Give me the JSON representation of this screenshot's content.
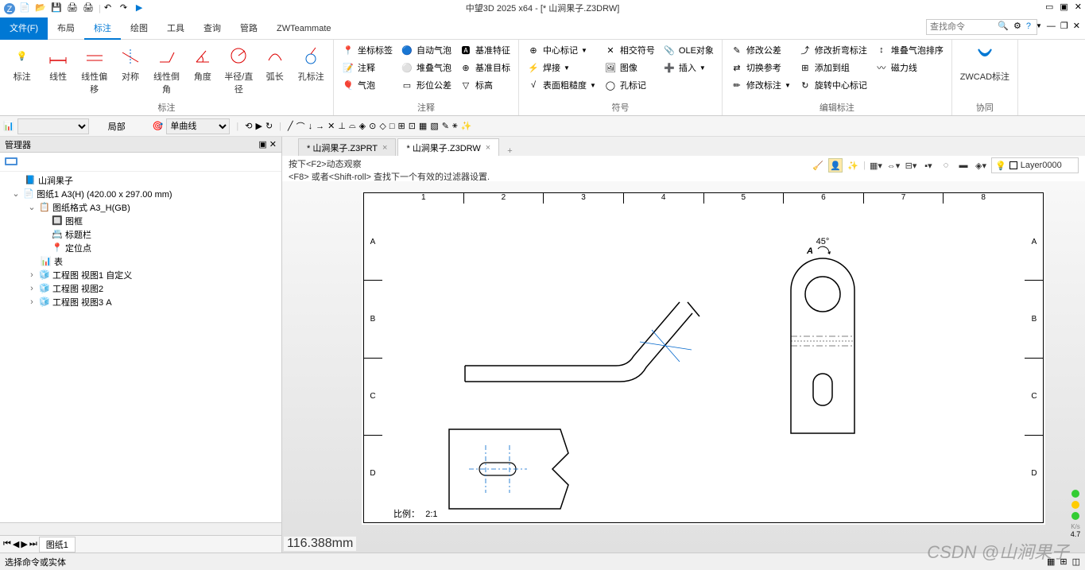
{
  "app": {
    "title": "中望3D 2025 x64 - [* 山涧果子.Z3DRW]"
  },
  "menu": {
    "file": "文件(F)",
    "items": [
      "布局",
      "标注",
      "绘图",
      "工具",
      "查询",
      "管路",
      "ZWTeammate"
    ],
    "active_index": 1,
    "search_placeholder": "查找命令"
  },
  "ribbon": {
    "groups": {
      "dim": {
        "label": "标注",
        "buttons": [
          "标注",
          "线性",
          "线性偏移",
          "对称",
          "线性倒角",
          "角度",
          "半径/直径",
          "弧长",
          "孔标注"
        ]
      },
      "annot": {
        "label": "注释",
        "c1": [
          "坐标标签",
          "注释",
          "气泡"
        ],
        "c2": [
          "自动气泡",
          "堆叠气泡",
          "形位公差"
        ],
        "c3": [
          "基准特征",
          "基准目标",
          "标高"
        ]
      },
      "symbol": {
        "label": "符号",
        "c1": [
          "中心标记",
          "焊接",
          "表面粗糙度"
        ],
        "c2": [
          "相交符号",
          "图像",
          "孔标记"
        ],
        "c3": [
          "OLE对象",
          "插入"
        ]
      },
      "edit": {
        "label": "编辑标注",
        "c1": [
          "修改公差",
          "切换参考",
          "修改标注"
        ],
        "c2": [
          "修改折弯标注",
          "添加到组",
          "旋转中心标记"
        ],
        "c3": [
          "堆叠气泡排序",
          "磁力线"
        ]
      },
      "coop": {
        "label": "协同",
        "btn": "ZWCAD标注"
      }
    }
  },
  "toolbar2": {
    "scope": "局部",
    "curve": "单曲线"
  },
  "manager": {
    "title": "管理器",
    "root": "山涧果子",
    "sheet": "图纸1 A3(H) (420.00 x 297.00 mm)",
    "format": "图纸格式 A3_H(GB)",
    "frame": "图框",
    "titleblock": "标题栏",
    "anchor": "定位点",
    "table": "表",
    "view1": "工程图 视图1 自定义",
    "view2": "工程图 视图2",
    "view3": "工程图 视图3 A",
    "nav_sheet": "图纸1"
  },
  "tabs": {
    "t1": "* 山涧果子.Z3PRT",
    "t2": "* 山涧果子.Z3DRW"
  },
  "hints": {
    "l1": "按下<F2>动态观察",
    "l2": "<F8> 或者<Shift-roll>  查找下一个有效的过滤器设置."
  },
  "layer": "Layer0000",
  "drawing": {
    "cols": [
      "1",
      "2",
      "3",
      "4",
      "5",
      "6",
      "7",
      "8"
    ],
    "rows": [
      "A",
      "B",
      "C",
      "D"
    ],
    "angle_label": "45°",
    "section_label": "A",
    "scale_label": "比例：",
    "scale_value": "2:1"
  },
  "readout": "116.388mm",
  "status": {
    "prompt": "选择命令或实体"
  },
  "watermark": "CSDN @山涧果子",
  "perf": {
    "kbs": "K/s",
    "val": "4.7"
  }
}
